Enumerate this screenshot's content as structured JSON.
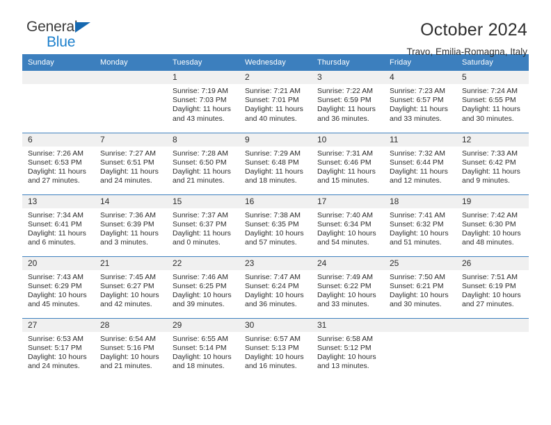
{
  "brand": {
    "line1": "General",
    "line2": "Blue",
    "accent_color": "#1b7fcc",
    "flag_color": "#1568b0"
  },
  "header": {
    "title": "October 2024",
    "subtitle": "Travo, Emilia-Romagna, Italy"
  },
  "theme": {
    "header_row_bg": "#3c7fbe",
    "daynum_bg": "#f0f0f0",
    "grid_line": "#3c7fbe"
  },
  "weekdays": [
    "Sunday",
    "Monday",
    "Tuesday",
    "Wednesday",
    "Thursday",
    "Friday",
    "Saturday"
  ],
  "weeks": [
    [
      {
        "day": "",
        "lines": []
      },
      {
        "day": "",
        "lines": []
      },
      {
        "day": "1",
        "lines": [
          "Sunrise: 7:19 AM",
          "Sunset: 7:03 PM",
          "Daylight: 11 hours",
          "and 43 minutes."
        ]
      },
      {
        "day": "2",
        "lines": [
          "Sunrise: 7:21 AM",
          "Sunset: 7:01 PM",
          "Daylight: 11 hours",
          "and 40 minutes."
        ]
      },
      {
        "day": "3",
        "lines": [
          "Sunrise: 7:22 AM",
          "Sunset: 6:59 PM",
          "Daylight: 11 hours",
          "and 36 minutes."
        ]
      },
      {
        "day": "4",
        "lines": [
          "Sunrise: 7:23 AM",
          "Sunset: 6:57 PM",
          "Daylight: 11 hours",
          "and 33 minutes."
        ]
      },
      {
        "day": "5",
        "lines": [
          "Sunrise: 7:24 AM",
          "Sunset: 6:55 PM",
          "Daylight: 11 hours",
          "and 30 minutes."
        ]
      }
    ],
    [
      {
        "day": "6",
        "lines": [
          "Sunrise: 7:26 AM",
          "Sunset: 6:53 PM",
          "Daylight: 11 hours",
          "and 27 minutes."
        ]
      },
      {
        "day": "7",
        "lines": [
          "Sunrise: 7:27 AM",
          "Sunset: 6:51 PM",
          "Daylight: 11 hours",
          "and 24 minutes."
        ]
      },
      {
        "day": "8",
        "lines": [
          "Sunrise: 7:28 AM",
          "Sunset: 6:50 PM",
          "Daylight: 11 hours",
          "and 21 minutes."
        ]
      },
      {
        "day": "9",
        "lines": [
          "Sunrise: 7:29 AM",
          "Sunset: 6:48 PM",
          "Daylight: 11 hours",
          "and 18 minutes."
        ]
      },
      {
        "day": "10",
        "lines": [
          "Sunrise: 7:31 AM",
          "Sunset: 6:46 PM",
          "Daylight: 11 hours",
          "and 15 minutes."
        ]
      },
      {
        "day": "11",
        "lines": [
          "Sunrise: 7:32 AM",
          "Sunset: 6:44 PM",
          "Daylight: 11 hours",
          "and 12 minutes."
        ]
      },
      {
        "day": "12",
        "lines": [
          "Sunrise: 7:33 AM",
          "Sunset: 6:42 PM",
          "Daylight: 11 hours",
          "and 9 minutes."
        ]
      }
    ],
    [
      {
        "day": "13",
        "lines": [
          "Sunrise: 7:34 AM",
          "Sunset: 6:41 PM",
          "Daylight: 11 hours",
          "and 6 minutes."
        ]
      },
      {
        "day": "14",
        "lines": [
          "Sunrise: 7:36 AM",
          "Sunset: 6:39 PM",
          "Daylight: 11 hours",
          "and 3 minutes."
        ]
      },
      {
        "day": "15",
        "lines": [
          "Sunrise: 7:37 AM",
          "Sunset: 6:37 PM",
          "Daylight: 11 hours",
          "and 0 minutes."
        ]
      },
      {
        "day": "16",
        "lines": [
          "Sunrise: 7:38 AM",
          "Sunset: 6:35 PM",
          "Daylight: 10 hours",
          "and 57 minutes."
        ]
      },
      {
        "day": "17",
        "lines": [
          "Sunrise: 7:40 AM",
          "Sunset: 6:34 PM",
          "Daylight: 10 hours",
          "and 54 minutes."
        ]
      },
      {
        "day": "18",
        "lines": [
          "Sunrise: 7:41 AM",
          "Sunset: 6:32 PM",
          "Daylight: 10 hours",
          "and 51 minutes."
        ]
      },
      {
        "day": "19",
        "lines": [
          "Sunrise: 7:42 AM",
          "Sunset: 6:30 PM",
          "Daylight: 10 hours",
          "and 48 minutes."
        ]
      }
    ],
    [
      {
        "day": "20",
        "lines": [
          "Sunrise: 7:43 AM",
          "Sunset: 6:29 PM",
          "Daylight: 10 hours",
          "and 45 minutes."
        ]
      },
      {
        "day": "21",
        "lines": [
          "Sunrise: 7:45 AM",
          "Sunset: 6:27 PM",
          "Daylight: 10 hours",
          "and 42 minutes."
        ]
      },
      {
        "day": "22",
        "lines": [
          "Sunrise: 7:46 AM",
          "Sunset: 6:25 PM",
          "Daylight: 10 hours",
          "and 39 minutes."
        ]
      },
      {
        "day": "23",
        "lines": [
          "Sunrise: 7:47 AM",
          "Sunset: 6:24 PM",
          "Daylight: 10 hours",
          "and 36 minutes."
        ]
      },
      {
        "day": "24",
        "lines": [
          "Sunrise: 7:49 AM",
          "Sunset: 6:22 PM",
          "Daylight: 10 hours",
          "and 33 minutes."
        ]
      },
      {
        "day": "25",
        "lines": [
          "Sunrise: 7:50 AM",
          "Sunset: 6:21 PM",
          "Daylight: 10 hours",
          "and 30 minutes."
        ]
      },
      {
        "day": "26",
        "lines": [
          "Sunrise: 7:51 AM",
          "Sunset: 6:19 PM",
          "Daylight: 10 hours",
          "and 27 minutes."
        ]
      }
    ],
    [
      {
        "day": "27",
        "lines": [
          "Sunrise: 6:53 AM",
          "Sunset: 5:17 PM",
          "Daylight: 10 hours",
          "and 24 minutes."
        ]
      },
      {
        "day": "28",
        "lines": [
          "Sunrise: 6:54 AM",
          "Sunset: 5:16 PM",
          "Daylight: 10 hours",
          "and 21 minutes."
        ]
      },
      {
        "day": "29",
        "lines": [
          "Sunrise: 6:55 AM",
          "Sunset: 5:14 PM",
          "Daylight: 10 hours",
          "and 18 minutes."
        ]
      },
      {
        "day": "30",
        "lines": [
          "Sunrise: 6:57 AM",
          "Sunset: 5:13 PM",
          "Daylight: 10 hours",
          "and 16 minutes."
        ]
      },
      {
        "day": "31",
        "lines": [
          "Sunrise: 6:58 AM",
          "Sunset: 5:12 PM",
          "Daylight: 10 hours",
          "and 13 minutes."
        ]
      },
      {
        "day": "",
        "lines": []
      },
      {
        "day": "",
        "lines": []
      }
    ]
  ]
}
